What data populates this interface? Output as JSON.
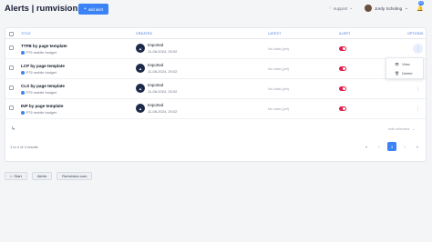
{
  "header": {
    "app_title": "Alerts | rumvision.com",
    "add_alert_label": "add alert",
    "support_label": "support",
    "user_name": "Jordy Scholing",
    "notification_count": "10"
  },
  "table": {
    "columns": {
      "title": "TITLE",
      "created": "CREATED",
      "latest": "LATEST",
      "alert": "ALERT",
      "options": "OPTIONS"
    },
    "rows": [
      {
        "title": "TTFB by page template",
        "subtitle": "P75 mobile budget",
        "created_label": "Imported",
        "created_date": "11-08-2024, 20:02",
        "latest": "No data (yet)"
      },
      {
        "title": "LCP by page template",
        "subtitle": "P75 mobile budget",
        "created_label": "Imported",
        "created_date": "11-08-2024, 20:02",
        "latest": "No data (yet)"
      },
      {
        "title": "CLS by page template",
        "subtitle": "P75 mobile budget",
        "created_label": "Imported",
        "created_date": "11-08-2024, 20:02",
        "latest": "No data (yet)"
      },
      {
        "title": "INP by page template",
        "subtitle": "P75 mobile budget",
        "created_label": "Imported",
        "created_date": "11-08-2024, 20:02",
        "latest": "No data (yet)"
      }
    ],
    "options_menu": {
      "view_label": "View",
      "delete_label": "Delete"
    },
    "with_selected_label": "with selected",
    "pagination_info": "1 to 4 of 4 results",
    "current_page": "1"
  },
  "breadcrumbs": {
    "start": "Start",
    "alerts": "Alerts",
    "site": "Rumvision.com"
  },
  "colors": {
    "accent": "#3b82f6",
    "toggle_on": "#e11d48"
  }
}
